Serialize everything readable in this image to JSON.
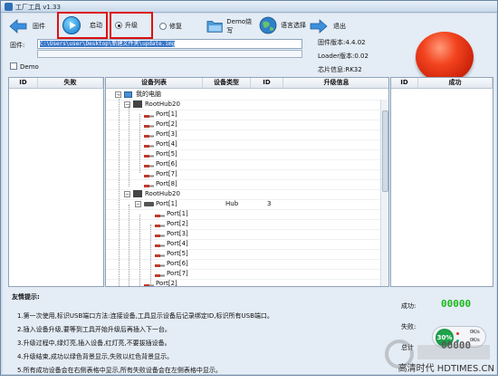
{
  "window": {
    "title": "工厂工具 v1.33"
  },
  "toolbar": {
    "firmware": "固件",
    "start": "启动",
    "upgrade": "升级",
    "repair": "修复",
    "demo_burn": "Demo烧写",
    "language": "语言选择",
    "exit": "退出"
  },
  "firmware_path": {
    "label": "固件:",
    "value": "C:\\Users\\user\\Desktop\\新建文件夹\\update.img"
  },
  "demo_checkbox": {
    "label": "Demo",
    "checked": false
  },
  "info": {
    "firmware_version": "固件版本:4.4.02",
    "loader_version": "Loader版本:0.02",
    "chip_info": "芯片信息:RK32"
  },
  "fail_panel": {
    "col_id": "ID",
    "col_name": "失败"
  },
  "success_panel": {
    "col_id": "ID",
    "col_name": "成功"
  },
  "device_table": {
    "headers": [
      "设备列表",
      "设备类型",
      "ID",
      "升级信息"
    ],
    "root": "我的电脑",
    "hub1": "RootHub20",
    "hub1_ports": [
      "Port[1]",
      "Port[2]",
      "Port[3]",
      "Port[4]",
      "Port[5]",
      "Port[6]",
      "Port[7]",
      "Port[8]"
    ],
    "hub2": "RootHub20",
    "hub2_port1": {
      "name": "Port[1]",
      "type": "Hub",
      "id": "3"
    },
    "hub2_subports": [
      "Port[1]",
      "Port[2]",
      "Port[3]",
      "Port[4]",
      "Port[5]",
      "Port[6]",
      "Port[7]"
    ],
    "hub2_port2": "Port[2]"
  },
  "tips": {
    "title": "友情提示:",
    "lines": [
      "1.第一次使用,标识USB端口方法:连接设备,工具显示设备后记录绑定ID,标识所有USB端口。",
      "2.插入设备升级,要等到工具开始升级后再插入下一台。",
      "3.升级过程中,绿灯亮,插入设备,红灯亮,不要拔插设备。",
      "4.升级结束,成功以绿色背景显示,失败以红色背景显示。",
      "5.所有成功设备会在右侧表格中显示,所有失败设备会在左侧表格中显示。"
    ]
  },
  "stats": {
    "success_label": "成功:",
    "success_value": "00000",
    "fail_label": "失败:",
    "fail_value": "0",
    "percent": "30%",
    "rate_up": "0K/s",
    "rate_down": "0K/s",
    "total_label": "总计",
    "total_value": "00000"
  },
  "watermark": "高清时代 HDTIMES.CN",
  "colors": {
    "success_green": "#1cb81c",
    "highlight_red": "#dd1111",
    "big_button_red": "#e43b17"
  }
}
